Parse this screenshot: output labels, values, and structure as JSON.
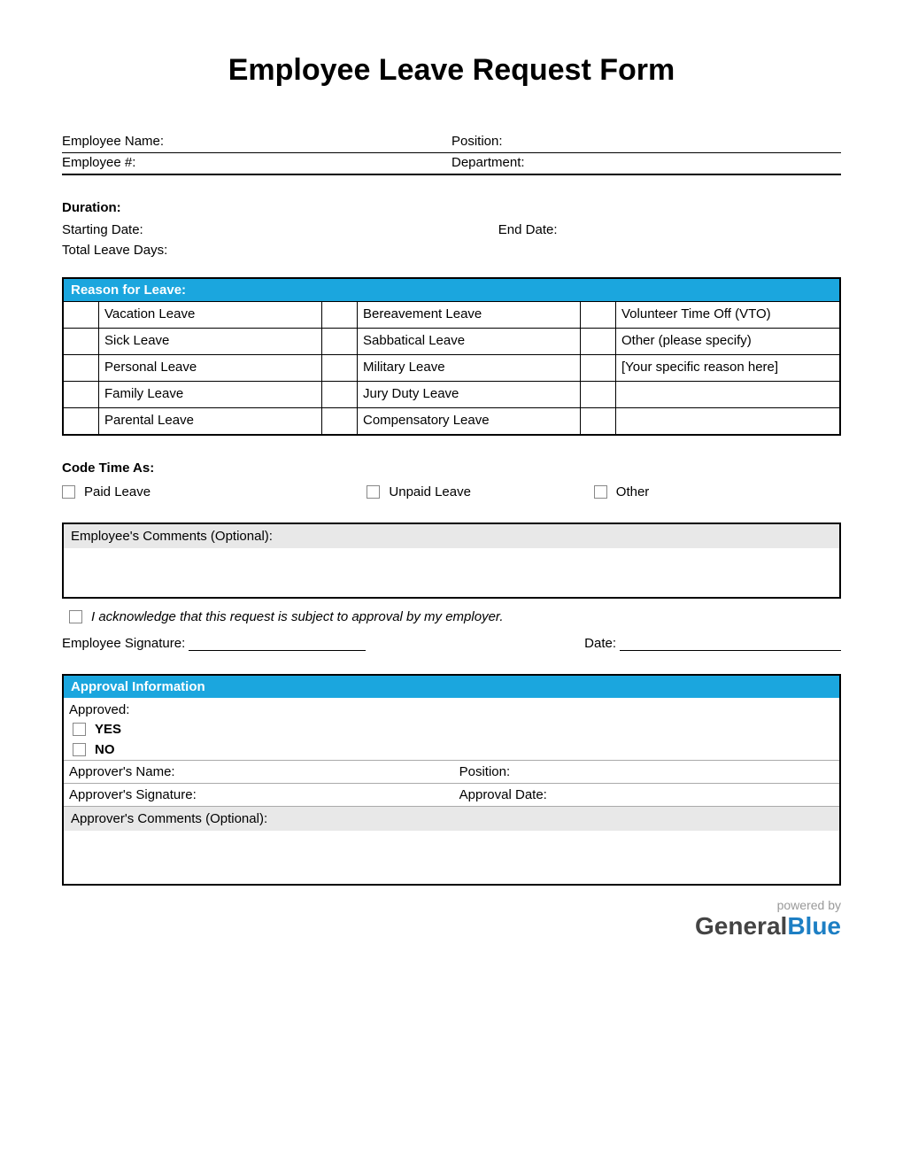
{
  "title": "Employee Leave Request Form",
  "fields": {
    "employee_name": "Employee Name:",
    "position": "Position:",
    "employee_num": "Employee #:",
    "department": "Department:"
  },
  "duration": {
    "heading": "Duration:",
    "start": "Starting Date:",
    "end": "End Date:",
    "total": "Total Leave Days:"
  },
  "reason": {
    "heading": "Reason for Leave:",
    "col1": [
      "Vacation Leave",
      "Sick Leave",
      "Personal Leave",
      "Family Leave",
      "Parental Leave"
    ],
    "col2": [
      "Bereavement Leave",
      "Sabbatical Leave",
      "Military Leave",
      "Jury Duty Leave",
      "Compensatory Leave"
    ],
    "col3": [
      "Volunteer Time Off (VTO)",
      "Other (please specify)",
      "[Your specific reason here]",
      "",
      ""
    ]
  },
  "codetime": {
    "heading": "Code Time As:",
    "options": [
      "Paid Leave",
      "Unpaid Leave",
      "Other"
    ]
  },
  "employee_comments_label": "Employee's Comments (Optional):",
  "ack_text": "I acknowledge that this request is subject to approval by my employer.",
  "employee_signature_label": "Employee Signature:",
  "date_label": "Date:",
  "approval": {
    "heading": "Approval Information",
    "approved_label": "Approved:",
    "yes": "YES",
    "no": "NO",
    "approver_name": "Approver's Name:",
    "position": "Position:",
    "approver_signature": "Approver's Signature:",
    "approval_date": "Approval Date:",
    "comments_label": "Approver's Comments (Optional):"
  },
  "footer": {
    "powered": "powered by",
    "brand1": "General",
    "brand2": "Blue"
  }
}
